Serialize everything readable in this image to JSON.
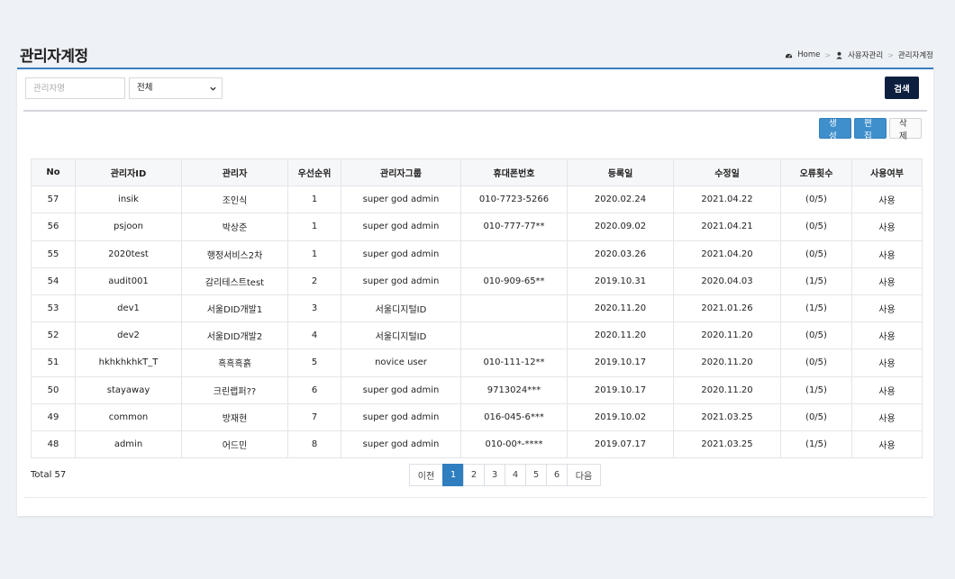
{
  "header": {
    "title": "관리자계정",
    "breadcrumb": {
      "home": "Home",
      "section": "사용자관리",
      "current": "관리자계정"
    }
  },
  "search": {
    "name_placeholder": "관리자명",
    "select_value": "전체",
    "search_label": "검색"
  },
  "actions": {
    "create_label": "생성",
    "edit_label": "편집",
    "delete_label": "삭제"
  },
  "table": {
    "columns": [
      "No",
      "관리자ID",
      "관리자",
      "우선순위",
      "관리자그룹",
      "휴대폰번호",
      "등록일",
      "수정일",
      "오류횟수",
      "사용여부"
    ],
    "rows": [
      [
        "57",
        "insik",
        "조인식",
        "1",
        "super god admin",
        "010-7723-5266",
        "2020.02.24",
        "2021.04.22",
        "(0/5)",
        "사용"
      ],
      [
        "56",
        "psjoon",
        "박상준",
        "1",
        "super god admin",
        "010-777-77**",
        "2020.09.02",
        "2021.04.21",
        "(0/5)",
        "사용"
      ],
      [
        "55",
        "2020test",
        "행정서비스2차",
        "1",
        "super god admin",
        "",
        "2020.03.26",
        "2021.04.20",
        "(0/5)",
        "사용"
      ],
      [
        "54",
        "audit001",
        "감리테스트test",
        "2",
        "super god admin",
        "010-909-65**",
        "2019.10.31",
        "2020.04.03",
        "(1/5)",
        "사용"
      ],
      [
        "53",
        "dev1",
        "서울DID개발1",
        "3",
        "서울디지털ID",
        "",
        "2020.11.20",
        "2021.01.26",
        "(1/5)",
        "사용"
      ],
      [
        "52",
        "dev2",
        "서울DID개발2",
        "4",
        "서울디지털ID",
        "",
        "2020.11.20",
        "2020.11.20",
        "(0/5)",
        "사용"
      ],
      [
        "51",
        "hkhkhkhkT_T",
        "흑흑흑흙",
        "5",
        "novice user",
        "010-111-12**",
        "2019.10.17",
        "2020.11.20",
        "(0/5)",
        "사용"
      ],
      [
        "50",
        "stayaway",
        "크린랩퍼??",
        "6",
        "super god admin",
        "9713024***",
        "2019.10.17",
        "2020.11.20",
        "(1/5)",
        "사용"
      ],
      [
        "49",
        "common",
        "방재현",
        "7",
        "super god admin",
        "016-045-6***",
        "2019.10.02",
        "2021.03.25",
        "(0/5)",
        "사용"
      ],
      [
        "48",
        "admin",
        "어드민",
        "8",
        "super god admin",
        "010-00*-****",
        "2019.07.17",
        "2021.03.25",
        "(1/5)",
        "사용"
      ]
    ]
  },
  "footer": {
    "total": "Total 57",
    "pagination": {
      "prev": "이전",
      "pages": [
        "1",
        "2",
        "3",
        "4",
        "5",
        "6"
      ],
      "next": "다음",
      "current": "1"
    }
  },
  "colors": {
    "accent": "#2f7ec0",
    "dark_button": "#0c1f3f",
    "blue_button": "#3f8fcc"
  },
  "icons": {
    "home": "dashboard-icon",
    "users": "user-icon",
    "select": "chevron-down-icon"
  }
}
